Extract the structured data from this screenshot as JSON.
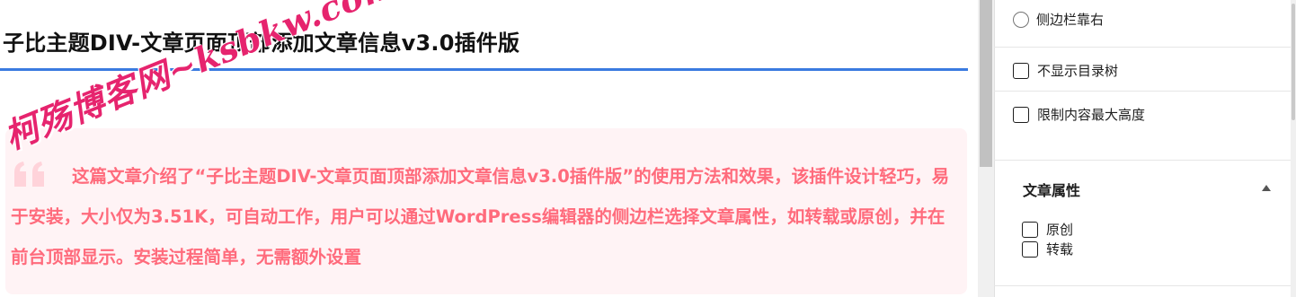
{
  "editor": {
    "post_title": "子比主题DIV-文章页面顶部添加文章信息v3.0插件版",
    "watermark": "柯殇博客网~ksbkw.com",
    "summary": "这篇文章介绍了“子比主题DIV-文章页面顶部添加文章信息v3.0插件版”的使用方法和效果，该插件设计轻巧，易于安装，大小仅为3.51K，可自动工作，用户可以通过WordPress编辑器的侧边栏选择文章属性，如转载或原创，并在前台顶部显示。安装过程简单，无需额外设置"
  },
  "sidebar": {
    "radio_sidebar_right": "侧边栏靠右",
    "check_hide_toc": "不显示目录树",
    "check_limit_height": "限制内容最大高度",
    "panel_title": "文章属性",
    "attr_options": [
      "原创",
      "转载"
    ]
  },
  "colors": {
    "accent_rule": "#3a7be0",
    "summary_text": "#ff6b7c",
    "summary_bg": "#fff3f5",
    "watermark": "#e6246e"
  }
}
